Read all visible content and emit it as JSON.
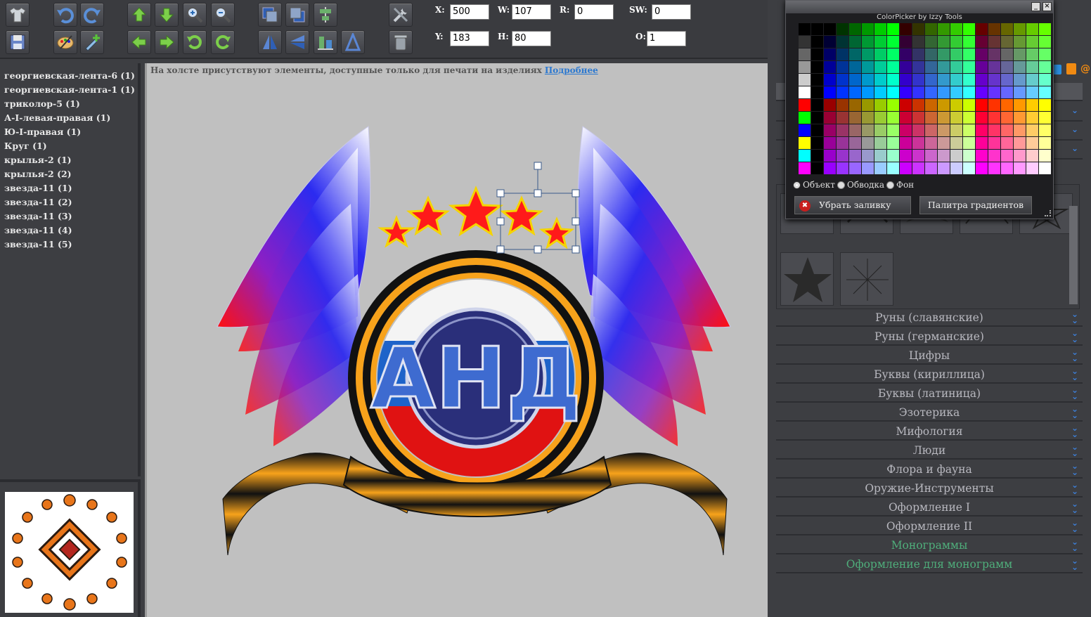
{
  "toolbar": {
    "fields": {
      "x": {
        "label": "X:",
        "value": "500"
      },
      "y": {
        "label": "Y:",
        "value": "183"
      },
      "w": {
        "label": "W:",
        "value": "107"
      },
      "h": {
        "label": "H:",
        "value": "80"
      },
      "r": {
        "label": "R:",
        "value": "0"
      },
      "sw": {
        "label": "SW:",
        "value": "0"
      },
      "o": {
        "label": "O:",
        "value": "1"
      }
    }
  },
  "layers": [
    "георгиевская-лента-6 (1)",
    "георгиевская-лента-1 (1)",
    "триколор-5 (1)",
    "А-I-левая-правая (1)",
    "Ю-I-правая (1)",
    "Круг (1)",
    "крылья-2 (1)",
    "крылья-2 (2)",
    "звезда-11 (1)",
    "звезда-11 (2)",
    "звезда-11 (3)",
    "звезда-11 (4)",
    "звезда-11 (5)"
  ],
  "canvas": {
    "notice": "На холсте присутствуют элементы, доступные только для печати на изделиях",
    "notice_link": "Подробнее",
    "logo_letters": "АНД"
  },
  "colorpicker": {
    "title": "ColorPicker by Izzy Tools",
    "radio_object": "Объект",
    "radio_stroke": "Обводка",
    "radio_bg": "Фон",
    "remove_fill": "Убрать заливку",
    "gradient_palette": "Палитра градиентов"
  },
  "categories": [
    {
      "label": "Руны (славянские)",
      "accent": false
    },
    {
      "label": "Руны (германские)",
      "accent": false
    },
    {
      "label": "Цифры",
      "accent": false
    },
    {
      "label": "Буквы (кириллица)",
      "accent": false
    },
    {
      "label": "Буквы (латиница)",
      "accent": false
    },
    {
      "label": "Эзотерика",
      "accent": false
    },
    {
      "label": "Мифология",
      "accent": false
    },
    {
      "label": "Люди",
      "accent": false
    },
    {
      "label": "Флора и фауна",
      "accent": false
    },
    {
      "label": "Оружие-Инструменты",
      "accent": false
    },
    {
      "label": "Оформление I",
      "accent": false
    },
    {
      "label": "Оформление II",
      "accent": false
    },
    {
      "label": "Монограммы",
      "accent": true
    },
    {
      "label": "Оформление для монограмм",
      "accent": true
    }
  ],
  "colors": {
    "accent_link": "#2b78d0",
    "category_text": "#b8b8bf",
    "category_accent": "#4fae7b",
    "star_fill": "#ff1a1a",
    "ribbon_orange": "#f7a21b"
  }
}
